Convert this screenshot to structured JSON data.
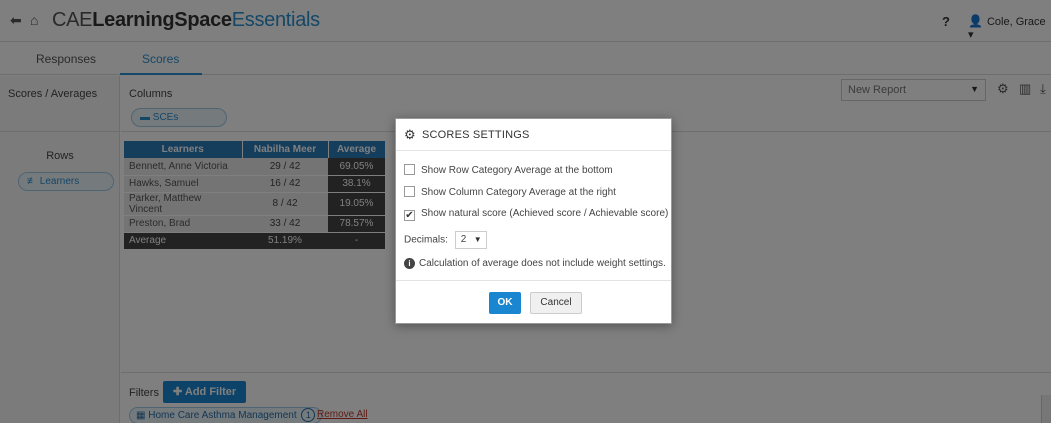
{
  "header": {
    "brand_part1": "CAE",
    "brand_part2": "LearningSpace",
    "brand_part3": "Essentials",
    "help": "?",
    "user": "Cole, Grace ▾",
    "back_icon": "arrow-left-icon",
    "home_icon": "home-icon",
    "user_icon": "user-icon"
  },
  "tabs": [
    {
      "label": "Responses"
    },
    {
      "label": "Scores"
    }
  ],
  "left": {
    "section_label": "Scores / Averages",
    "rows_title": "Rows",
    "rows_pill": "Learners"
  },
  "columns": {
    "label": "Columns",
    "pill": "SCEs"
  },
  "report": {
    "value": "New Report"
  },
  "table": {
    "headers": [
      "Learners",
      "Nabilha Meer",
      "Average"
    ],
    "rows": [
      {
        "name": "Bennett, Anne Victoria",
        "score": "29 / 42",
        "average": "69.05%"
      },
      {
        "name": "Hawks, Samuel",
        "score": "16 / 42",
        "average": "38.1%"
      },
      {
        "name": "Parker, Matthew Vincent",
        "score": "8 / 42",
        "average": "19.05%"
      },
      {
        "name": "Preston, Brad",
        "score": "33 / 42",
        "average": "78.57%"
      }
    ],
    "average_row": {
      "name": "Average",
      "score": "51.19%",
      "average": "-"
    }
  },
  "filters": {
    "label": "Filters",
    "add_button": "Add Filter",
    "pill": "Home Care Asthma Management",
    "pill_count": "1",
    "remove_all": "Remove All"
  },
  "modal": {
    "title": "SCORES SETTINGS",
    "options": [
      {
        "label": "Show Row Category Average at the bottom",
        "checked": false
      },
      {
        "label": "Show Column Category Average at the right",
        "checked": false
      },
      {
        "label": "Show natural score (Achieved score / Achievable score)",
        "checked": true
      }
    ],
    "decimals_label": "Decimals:",
    "decimals_value": "2",
    "note": "Calculation of average does not include weight settings.",
    "ok": "OK",
    "cancel": "Cancel"
  },
  "colors": {
    "accent": "#1a86d0",
    "header_blue": "#2a7ab8",
    "danger": "#c0392b"
  }
}
